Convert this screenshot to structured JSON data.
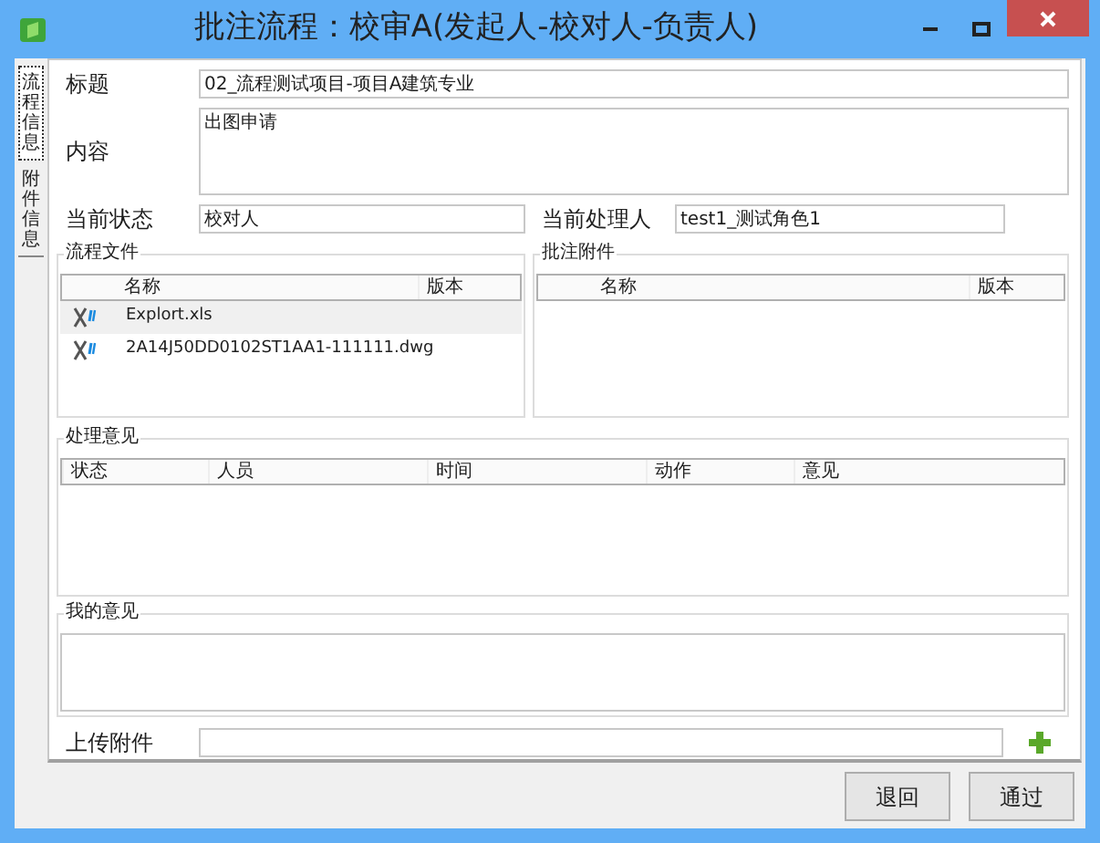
{
  "window": {
    "title": "批注流程：校审A(发起人-校对人-负责人)"
  },
  "side_tabs": [
    {
      "label": "流程信息",
      "selected": true
    },
    {
      "label": "附件信息",
      "selected": false
    }
  ],
  "fields": {
    "title": {
      "label": "标题",
      "value": "02_流程测试项目-项目A建筑专业"
    },
    "content": {
      "label": "内容",
      "value": "出图申请"
    },
    "current_state": {
      "label": "当前状态",
      "value": "校对人"
    },
    "current_handler": {
      "label": "当前处理人",
      "value": "test1_测试角色1"
    }
  },
  "process_files": {
    "title": "流程文件",
    "columns": [
      "名称",
      "版本"
    ],
    "rows": [
      {
        "name": "Explort.xls",
        "selected": true
      },
      {
        "name": "2A14J50DD0102ST1AA1-111111.dwg",
        "selected": false
      }
    ]
  },
  "annotation_attachments": {
    "title": "批注附件",
    "columns": [
      "名称",
      "版本"
    ]
  },
  "opinions": {
    "title": "处理意见",
    "columns": [
      "状态",
      "人员",
      "时间",
      "动作",
      "意见"
    ]
  },
  "my_opinion": {
    "title": "我的意见"
  },
  "upload": {
    "label": "上传附件"
  },
  "buttons": [
    "退回",
    "通过"
  ]
}
